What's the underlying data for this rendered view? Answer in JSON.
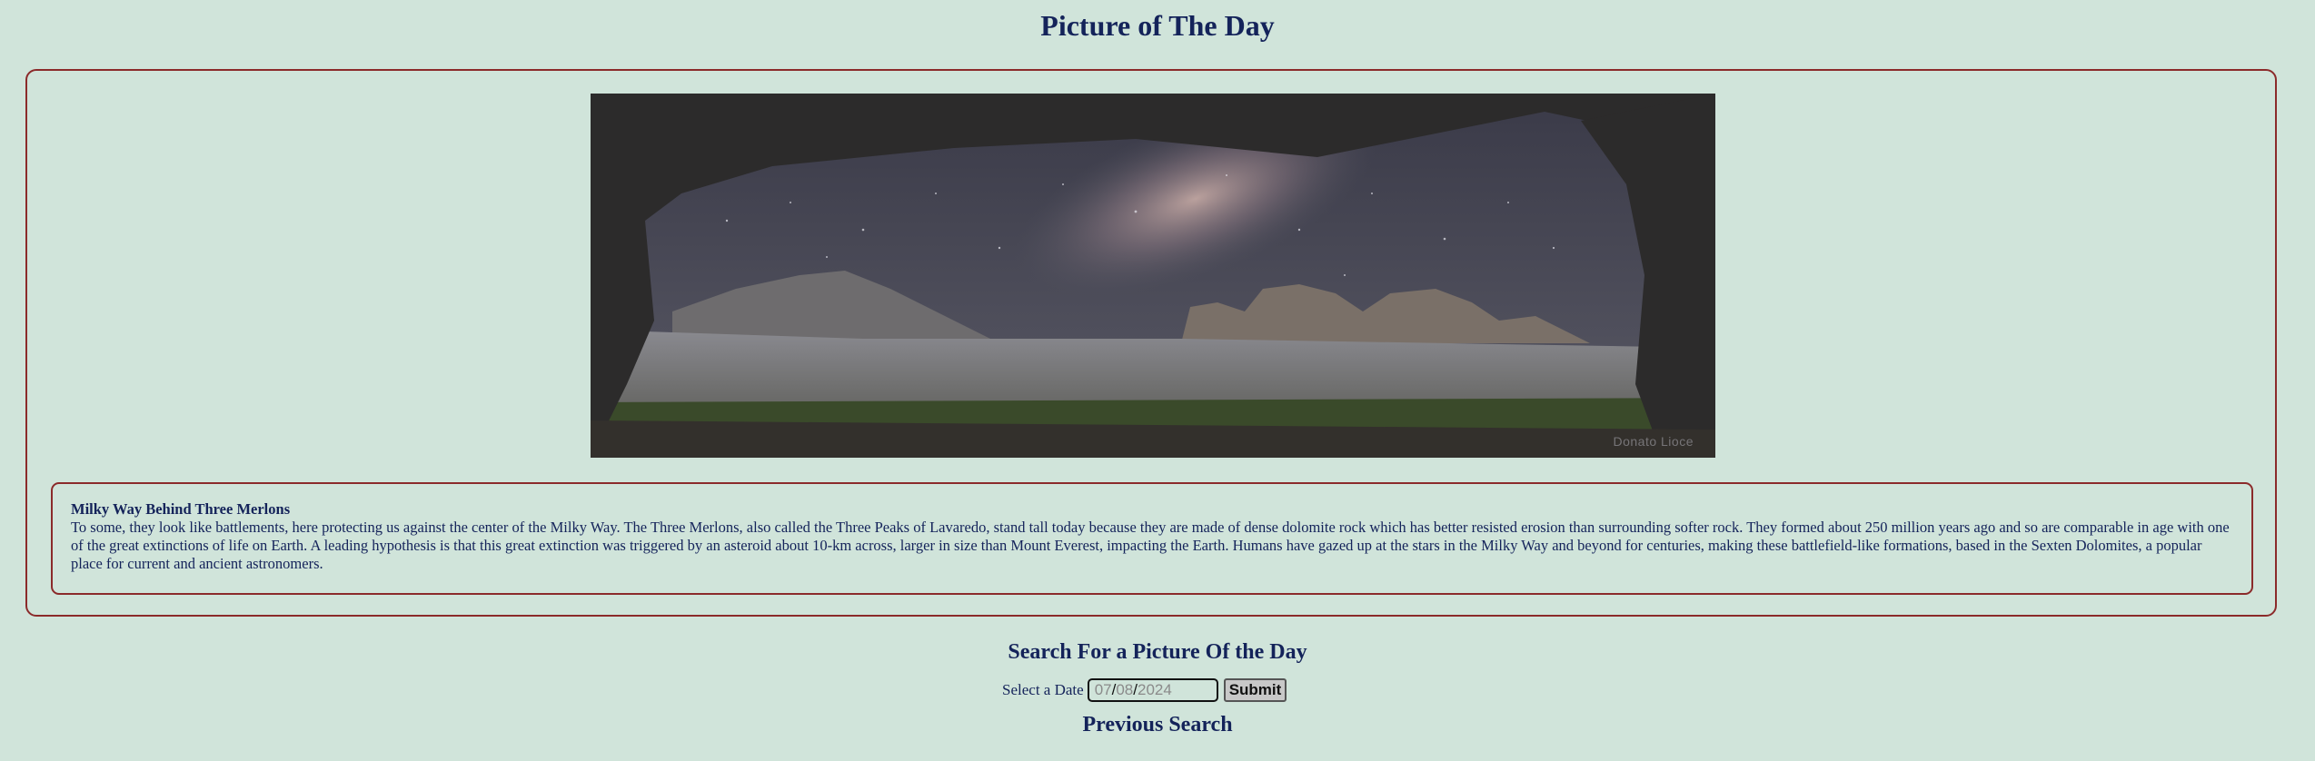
{
  "page": {
    "title": "Picture of The Day"
  },
  "picture": {
    "image_credit": "Donato Lioce",
    "title": "Milky Way Behind Three Merlons",
    "explanation": "To some, they look like battlements, here protecting us against the center of the Milky Way. The Three Merlons, also called the Three Peaks of Lavaredo, stand tall today because they are made of dense dolomite rock which has better resisted erosion than surrounding softer rock. They formed about 250 million years ago and so are comparable in age with one of the great extinctions of life on Earth. A leading hypothesis is that this great extinction was triggered by an asteroid about 10-km across, larger in size than Mount Everest, impacting the Earth. Humans have gazed up at the stars in the Milky Way and beyond for centuries, making these battlefield-like formations, based in the Sexten Dolomites, a popular place for current and ancient astronomers."
  },
  "search": {
    "heading": "Search For a Picture Of the Day",
    "date_label": "Select a Date",
    "date_placeholder": {
      "month": "07",
      "day": "08",
      "year": "2024",
      "separator": "/"
    },
    "submit_label": "Submit"
  },
  "previous": {
    "heading": "Previous Search"
  }
}
